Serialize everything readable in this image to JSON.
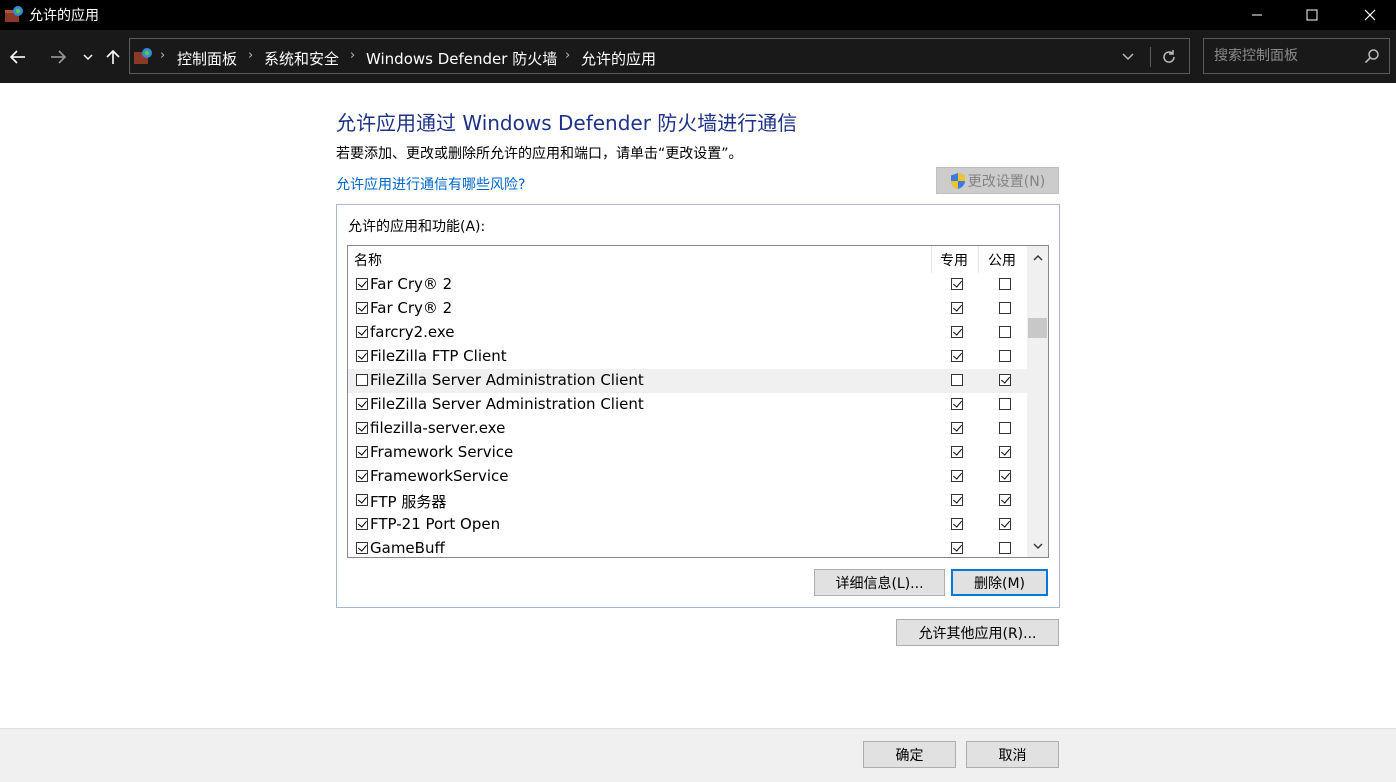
{
  "window": {
    "title": "允许的应用",
    "controls": {
      "minimize": "minimize-icon",
      "maximize": "maximize-icon",
      "close": "close-icon"
    }
  },
  "nav": {
    "icons": [
      "back-arrow-icon",
      "forward-arrow-icon",
      "recent-locations-icon",
      "up-arrow-icon"
    ],
    "breadcrumb": [
      "控制面板",
      "系统和安全",
      "Windows Defender 防火墙",
      "允许的应用"
    ],
    "search_placeholder": "搜索控制面板"
  },
  "main": {
    "heading": "允许应用通过 Windows Defender 防火墙进行通信",
    "instruction": "若要添加、更改或删除所允许的应用和端口，请单击“更改设置”。",
    "risk_link": "允许应用进行通信有哪些风险?",
    "change_settings_label": "更改设置(N)",
    "group_label": "允许的应用和功能(A):",
    "columns": {
      "name": "名称",
      "private": "专用",
      "public": "公用"
    },
    "rows": [
      {
        "name": "Far Cry® 2",
        "enabled": true,
        "private": true,
        "public": false,
        "selected": false
      },
      {
        "name": "Far Cry® 2",
        "enabled": true,
        "private": true,
        "public": false,
        "selected": false
      },
      {
        "name": "farcry2.exe",
        "enabled": true,
        "private": true,
        "public": false,
        "selected": false
      },
      {
        "name": "FileZilla FTP Client",
        "enabled": true,
        "private": true,
        "public": false,
        "selected": false
      },
      {
        "name": "FileZilla Server Administration Client",
        "enabled": false,
        "private": false,
        "public": true,
        "selected": true
      },
      {
        "name": "FileZilla Server Administration Client",
        "enabled": true,
        "private": true,
        "public": false,
        "selected": false
      },
      {
        "name": "filezilla-server.exe",
        "enabled": true,
        "private": true,
        "public": false,
        "selected": false
      },
      {
        "name": "Framework Service",
        "enabled": true,
        "private": true,
        "public": true,
        "selected": false
      },
      {
        "name": "FrameworkService",
        "enabled": true,
        "private": true,
        "public": true,
        "selected": false
      },
      {
        "name": "FTP 服务器",
        "enabled": true,
        "private": true,
        "public": true,
        "selected": false
      },
      {
        "name": "FTP-21 Port Open",
        "enabled": true,
        "private": true,
        "public": true,
        "selected": false
      },
      {
        "name": "GameBuff",
        "enabled": true,
        "private": true,
        "public": false,
        "selected": false
      }
    ],
    "details_label": "详细信息(L)...",
    "remove_label": "删除(M)",
    "allow_other_label": "允许其他应用(R)..."
  },
  "footer": {
    "ok_label": "确定",
    "cancel_label": "取消"
  },
  "colors": {
    "heading": "#1e3287",
    "link": "#0066cc",
    "titlebar": "#000000",
    "navbar": "#191919",
    "focus": "#0078d7"
  }
}
